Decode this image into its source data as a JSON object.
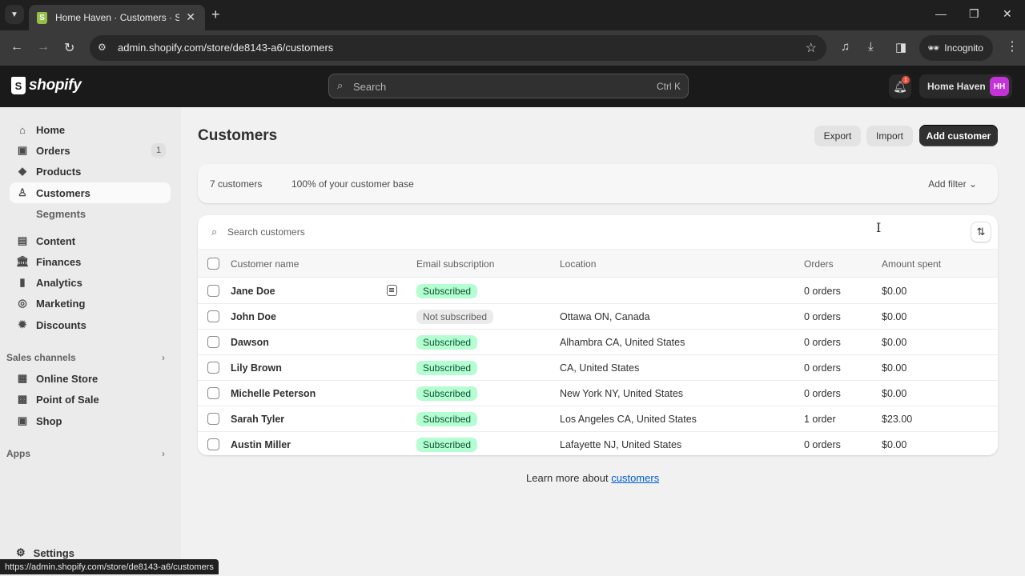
{
  "browser": {
    "tab_title": "Home Haven · Customers · Shopify",
    "url": "admin.shopify.com/store/de8143-a6/customers",
    "incognito_label": "Incognito",
    "status_url": "https://admin.shopify.com/store/de8143-a6/customers"
  },
  "topbar": {
    "logo_text": "shopify",
    "search_placeholder": "Search",
    "search_shortcut": "Ctrl K",
    "notification_count": "1",
    "store_name": "Home Haven",
    "avatar_initials": "HH"
  },
  "sidebar": {
    "items": [
      {
        "label": "Home",
        "icon": "home-icon"
      },
      {
        "label": "Orders",
        "icon": "orders-icon",
        "count": "1"
      },
      {
        "label": "Products",
        "icon": "tag-icon"
      },
      {
        "label": "Customers",
        "icon": "person-icon",
        "active": true
      },
      {
        "label": "Segments",
        "sub": true
      },
      {
        "label": "Content",
        "icon": "content-icon"
      },
      {
        "label": "Finances",
        "icon": "bank-icon"
      },
      {
        "label": "Analytics",
        "icon": "bar-chart-icon"
      },
      {
        "label": "Marketing",
        "icon": "target-icon"
      },
      {
        "label": "Discounts",
        "icon": "discount-icon"
      }
    ],
    "sales_channels_label": "Sales channels",
    "channels": [
      {
        "label": "Online Store",
        "icon": "store-icon"
      },
      {
        "label": "Point of Sale",
        "icon": "pos-icon"
      },
      {
        "label": "Shop",
        "icon": "shop-icon"
      }
    ],
    "apps_label": "Apps",
    "settings_label": "Settings"
  },
  "page": {
    "title": "Customers",
    "export_label": "Export",
    "import_label": "Import",
    "add_customer_label": "Add customer",
    "customer_count": "7 customers",
    "customer_base": "100% of your customer base",
    "add_filter_label": "Add filter",
    "search_placeholder": "Search customers",
    "columns": {
      "name": "Customer name",
      "email": "Email subscription",
      "location": "Location",
      "orders": "Orders",
      "amount": "Amount spent"
    },
    "rows": [
      {
        "name": "Jane Doe",
        "has_note": true,
        "subscription": "Subscribed",
        "subscribed": true,
        "location": "",
        "orders": "0 orders",
        "amount": "$0.00"
      },
      {
        "name": "John Doe",
        "has_note": false,
        "subscription": "Not subscribed",
        "subscribed": false,
        "location": "Ottawa ON, Canada",
        "orders": "0 orders",
        "amount": "$0.00"
      },
      {
        "name": "Dawson",
        "has_note": false,
        "subscription": "Subscribed",
        "subscribed": true,
        "location": "Alhambra CA, United States",
        "orders": "0 orders",
        "amount": "$0.00"
      },
      {
        "name": "Lily Brown",
        "has_note": false,
        "subscription": "Subscribed",
        "subscribed": true,
        "location": "CA, United States",
        "orders": "0 orders",
        "amount": "$0.00"
      },
      {
        "name": "Michelle Peterson",
        "has_note": false,
        "subscription": "Subscribed",
        "subscribed": true,
        "location": "New York NY, United States",
        "orders": "0 orders",
        "amount": "$0.00"
      },
      {
        "name": "Sarah Tyler",
        "has_note": false,
        "subscription": "Subscribed",
        "subscribed": true,
        "location": "Los Angeles CA, United States",
        "orders": "1 order",
        "amount": "$23.00"
      },
      {
        "name": "Austin Miller",
        "has_note": false,
        "subscription": "Subscribed",
        "subscribed": true,
        "location": "Lafayette NJ, United States",
        "orders": "0 orders",
        "amount": "$0.00"
      }
    ],
    "learn_more_prefix": "Learn more about ",
    "learn_more_link": "customers"
  },
  "colors": {
    "subscribed_bg": "#b4fed2",
    "subscribed_text": "#0c5132",
    "avatar_bg": "#c433d8",
    "primary_button": "#303030",
    "link": "#005bd3"
  }
}
